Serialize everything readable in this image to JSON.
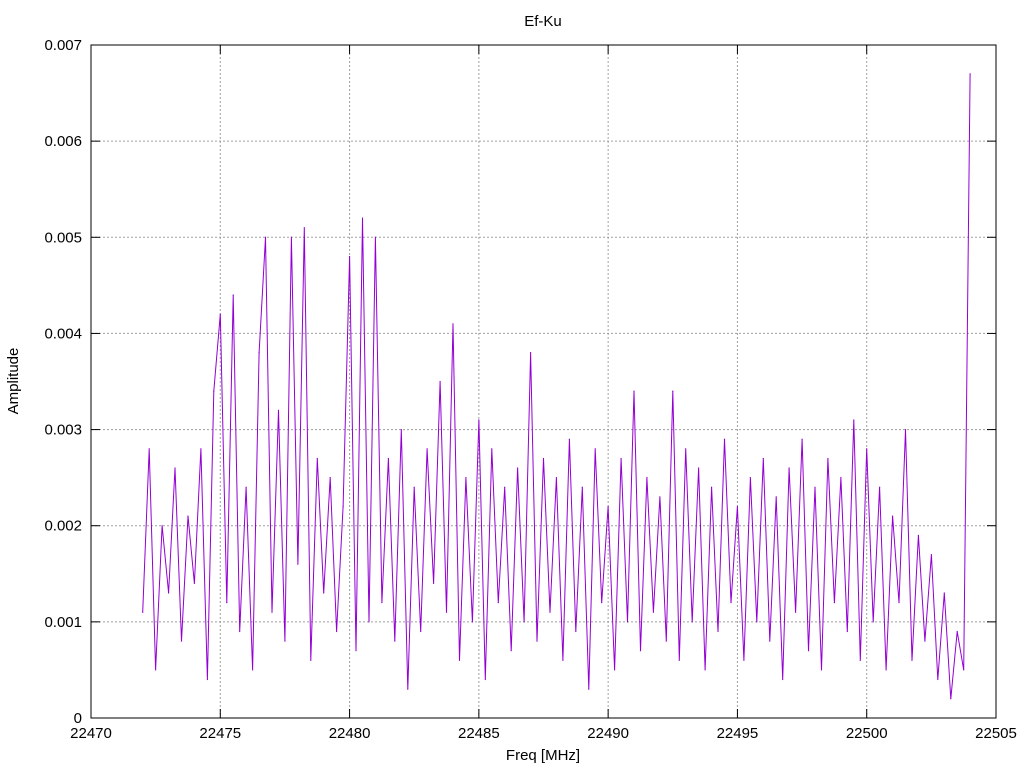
{
  "chart_data": {
    "type": "line",
    "title": "Ef-Ku",
    "xlabel": "Freq [MHz]",
    "ylabel": "Amplitude",
    "xlim": [
      22470,
      22505
    ],
    "ylim": [
      0,
      0.007
    ],
    "grid": true,
    "legend": "none",
    "line_color": "#9400d3",
    "x_ticks": [
      "22470",
      "22475",
      "22480",
      "22485",
      "22490",
      "22495",
      "22500",
      "22505"
    ],
    "y_ticks": [
      "0",
      "0.001",
      "0.002",
      "0.003",
      "0.004",
      "0.005",
      "0.006",
      "0.007"
    ],
    "series": [
      {
        "name": "Ef-Ku",
        "x_start": 22472,
        "x_step": 0.25,
        "values": [
          0.0011,
          0.0028,
          0.0005,
          0.002,
          0.0013,
          0.0026,
          0.0008,
          0.0021,
          0.0014,
          0.0028,
          0.0004,
          0.0034,
          0.0042,
          0.0012,
          0.0044,
          0.0009,
          0.0024,
          0.0005,
          0.0038,
          0.005,
          0.0011,
          0.0032,
          0.0008,
          0.005,
          0.0016,
          0.0051,
          0.0006,
          0.0027,
          0.0013,
          0.0025,
          0.0009,
          0.0022,
          0.0048,
          0.0007,
          0.0052,
          0.001,
          0.005,
          0.0012,
          0.0027,
          0.0008,
          0.003,
          0.0003,
          0.0024,
          0.0009,
          0.0028,
          0.0014,
          0.0035,
          0.0011,
          0.0041,
          0.0006,
          0.0025,
          0.001,
          0.0031,
          0.0004,
          0.0028,
          0.0012,
          0.0024,
          0.0007,
          0.0026,
          0.001,
          0.0038,
          0.0008,
          0.0027,
          0.0011,
          0.0025,
          0.0006,
          0.0029,
          0.0009,
          0.0024,
          0.0003,
          0.0028,
          0.0012,
          0.0022,
          0.0005,
          0.0027,
          0.001,
          0.0034,
          0.0007,
          0.0025,
          0.0011,
          0.0023,
          0.0008,
          0.0034,
          0.0006,
          0.0028,
          0.001,
          0.0026,
          0.0005,
          0.0024,
          0.0009,
          0.0029,
          0.0012,
          0.0022,
          0.0006,
          0.0025,
          0.001,
          0.0027,
          0.0008,
          0.0023,
          0.0004,
          0.0026,
          0.0011,
          0.0029,
          0.0007,
          0.0024,
          0.0005,
          0.0027,
          0.0012,
          0.0025,
          0.0009,
          0.0031,
          0.0006,
          0.0028,
          0.001,
          0.0024,
          0.0005,
          0.0021,
          0.0012,
          0.003,
          0.0006,
          0.0019,
          0.0008,
          0.0017,
          0.0004,
          0.0013,
          0.0002,
          0.0009,
          0.0005,
          0.0067
        ]
      }
    ]
  }
}
